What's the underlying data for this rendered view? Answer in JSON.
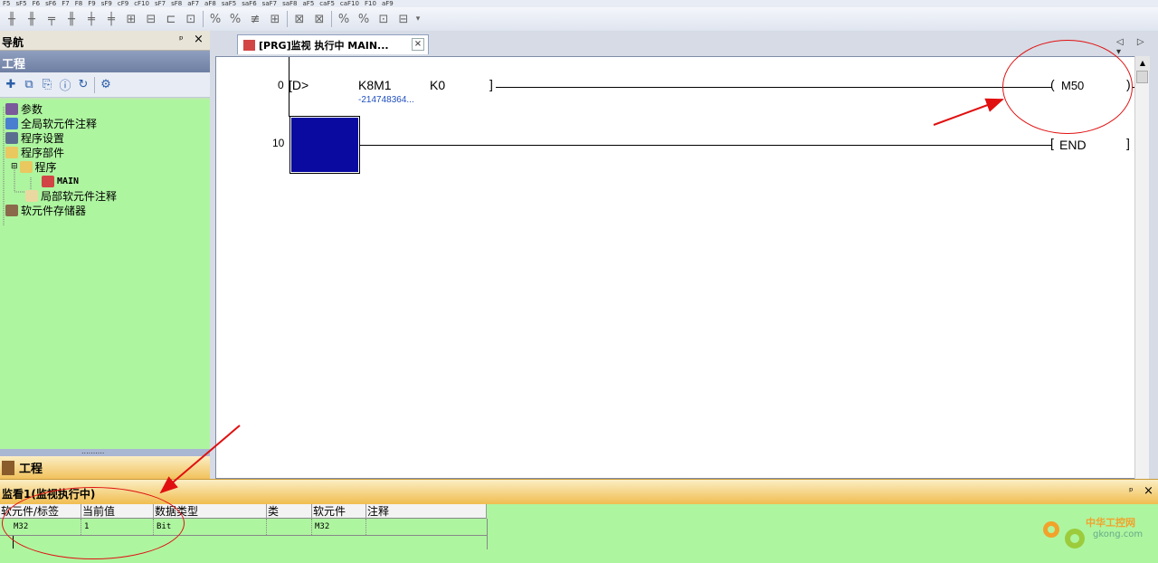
{
  "toolbar_top": {
    "labels": [
      "F5",
      "sF5",
      "F6",
      "sF6",
      "F7",
      "F8",
      "F9",
      "sF9",
      "cF9",
      "cF10",
      "sF7",
      "sF8",
      "aF7",
      "aF8",
      "saF5",
      "saF6",
      "saF7",
      "saF8",
      "aF5",
      "caF5",
      "caF10",
      "F10",
      "aF9"
    ]
  },
  "nav": {
    "title": "导航",
    "pin": "ᵖ",
    "close": "×",
    "section_title": "工程",
    "tree": [
      {
        "label": "参数",
        "icon": "params-icon"
      },
      {
        "label": "全局软元件注释",
        "icon": "global-comment-icon"
      },
      {
        "label": "程序设置",
        "icon": "program-setting-icon"
      },
      {
        "label": "程序部件",
        "icon": "program-parts-icon"
      },
      {
        "label": "程序",
        "icon": "program-folder-icon"
      },
      {
        "label": "MAIN",
        "icon": "main-program-icon"
      },
      {
        "label": "局部软元件注释",
        "icon": "local-comment-icon"
      },
      {
        "label": "软元件存储器",
        "icon": "device-memory-icon"
      }
    ],
    "splitter_dots": "..........",
    "bottom_tab": "工程"
  },
  "editor": {
    "tab_label": "[PRG]监视 执行中 MAIN...",
    "tab_icon": "prg-icon",
    "tab_close": "×",
    "tab_nav": "◁ ▷ ▾",
    "rungs": [
      {
        "step": "0",
        "instr_open": "[D>",
        "operand1": "K8M1",
        "operand1_value": "-214748364...",
        "operand2": "K0",
        "close_bracket": "]",
        "coil": "M50"
      },
      {
        "step": "10",
        "end_label": "END"
      }
    ]
  },
  "watch": {
    "title": "监看1(监视执行中)",
    "pin": "ᵖ",
    "close": "×",
    "columns": [
      "软元件/标签",
      "当前值",
      "数据类型",
      "类",
      "软元件",
      "注释"
    ],
    "rows": [
      {
        "device": "M32",
        "value": "1",
        "type": "Bit",
        "class": "",
        "device2": "M32",
        "comment": ""
      }
    ]
  },
  "watermark": {
    "cn": "中华工控网",
    "en": "gkong.com"
  },
  "colors": {
    "panel_green": "#aef5a0",
    "cursor_blue": "#0a0aa0",
    "annotation_red": "#e01010",
    "header_orange": "#f0bd50"
  }
}
